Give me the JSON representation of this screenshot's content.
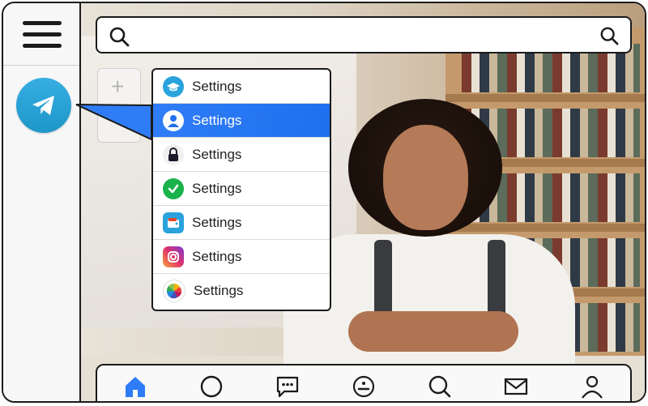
{
  "search": {
    "value": "",
    "placeholder": "",
    "icon_left": "search-icon",
    "icon_right": "search-icon"
  },
  "rail": {
    "menu_icon": "hamburger-menu-icon",
    "app_icon": "telegram-icon",
    "app_color": "#2AA3DD"
  },
  "dropdown": {
    "items": [
      {
        "label": "Settings",
        "icon": "graduation-cap-icon",
        "active": false
      },
      {
        "label": "Settings",
        "icon": "user-icon",
        "active": true
      },
      {
        "label": "Settings",
        "icon": "lock-icon",
        "active": false
      },
      {
        "label": "Settings",
        "icon": "check-circle-icon",
        "active": false
      },
      {
        "label": "Settings",
        "icon": "wallet-icon",
        "active": false
      },
      {
        "label": "Settings",
        "icon": "instagram-icon",
        "active": false
      },
      {
        "label": "Settings",
        "icon": "photos-pinwheel-icon",
        "active": false
      }
    ],
    "active_color": "#2F7DF6"
  },
  "bottom_nav": {
    "items": [
      {
        "icon": "home-icon",
        "active": true
      },
      {
        "icon": "circle-icon",
        "active": false
      },
      {
        "icon": "chat-bubble-icon",
        "active": false
      },
      {
        "icon": "smiley-icon",
        "active": false
      },
      {
        "icon": "search-icon",
        "active": false
      },
      {
        "icon": "mail-icon",
        "active": false
      },
      {
        "icon": "profile-icon",
        "active": false
      }
    ],
    "active_color": "#2F7DF6"
  }
}
